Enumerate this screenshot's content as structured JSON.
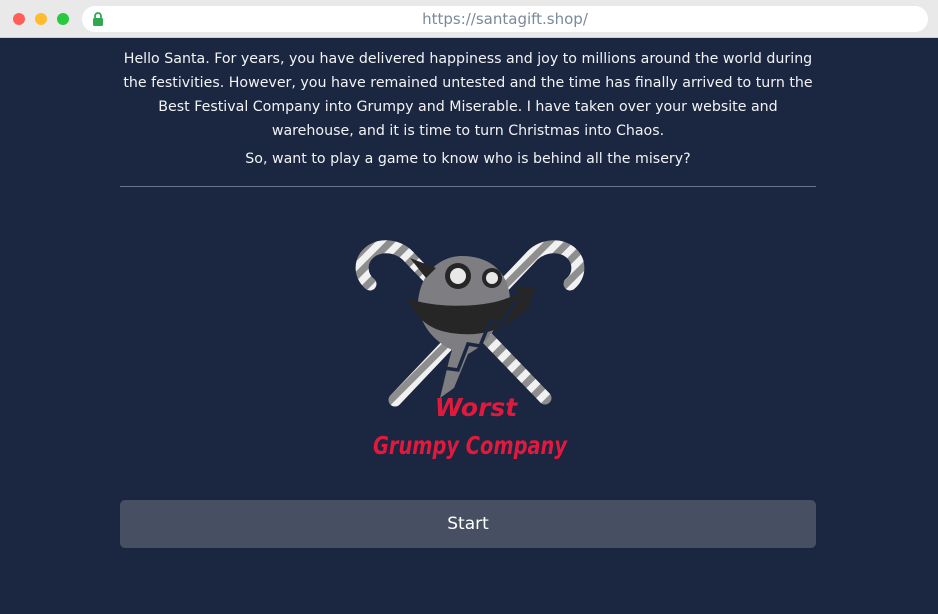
{
  "browser": {
    "url": "https://santagift.shop/"
  },
  "intro": {
    "paragraph": "Hello Santa. For years, you have delivered happiness and joy to millions around the world during the festivities. However, you have remained untested and the time has finally arrived to turn the Best Festival Company into Grumpy and Miserable. I have taken over your website and warehouse, and it is time to turn Christmas into Chaos.",
    "question": "So, want to play a game to know who is behind all the misery?"
  },
  "logo": {
    "line1": "Worst",
    "line2": "Grumpy Company",
    "text_color": "#e1193c"
  },
  "start_button": {
    "label": "Start"
  },
  "colors": {
    "background": "#1b2640",
    "button": "#474f63",
    "divider": "#6a738a"
  }
}
